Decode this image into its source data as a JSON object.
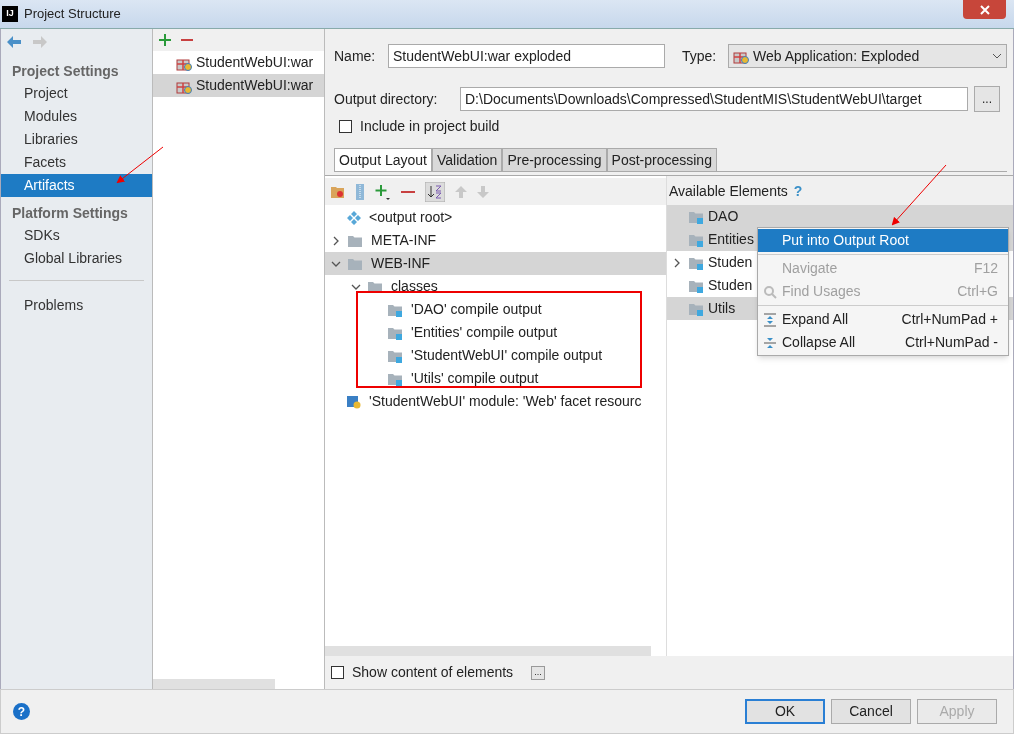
{
  "window": {
    "title": "Project Structure",
    "app_badge": "IJ"
  },
  "sidebar": {
    "sections": [
      {
        "title": "Project Settings",
        "items": [
          {
            "label": "Project",
            "selected": false
          },
          {
            "label": "Modules",
            "selected": false
          },
          {
            "label": "Libraries",
            "selected": false
          },
          {
            "label": "Facets",
            "selected": false
          },
          {
            "label": "Artifacts",
            "selected": true
          }
        ]
      },
      {
        "title": "Platform Settings",
        "items": [
          {
            "label": "SDKs",
            "selected": false
          },
          {
            "label": "Global Libraries",
            "selected": false
          }
        ]
      },
      {
        "items": [
          {
            "label": "Problems",
            "selected": false
          }
        ]
      }
    ]
  },
  "artifacts": [
    {
      "label": "StudentWebUI:war",
      "selected": false
    },
    {
      "label": "StudentWebUI:war",
      "selected": true
    }
  ],
  "form": {
    "name_label": "Name:",
    "name_value": "StudentWebUI:war exploded",
    "type_label": "Type:",
    "type_value": "Web Application: Exploded",
    "output_label": "Output directory:",
    "output_value": "D:\\Documents\\Downloads\\Compressed\\StudentMIS\\StudentWebUI\\target",
    "browse": "...",
    "include_label": "Include in project build",
    "include_checked": false
  },
  "tabs": [
    {
      "label": "Output Layout",
      "selected": true
    },
    {
      "label": "Validation",
      "selected": false
    },
    {
      "label": "Pre-processing",
      "selected": false
    },
    {
      "label": "Post-processing",
      "selected": false
    }
  ],
  "layout_tree": [
    {
      "kind": "root",
      "label": "<output root>",
      "selected": false
    },
    {
      "kind": "folder",
      "label": "META-INF",
      "expanded": false,
      "selected": false
    },
    {
      "kind": "folder",
      "label": "WEB-INF",
      "expanded": true,
      "selected": true,
      "children": [
        {
          "kind": "folder",
          "label": "classes",
          "expanded": true,
          "selected": false,
          "children": [
            {
              "kind": "output",
              "label": "'DAO' compile output",
              "selected": false
            },
            {
              "kind": "output",
              "label": "'Entities' compile output",
              "selected": false
            },
            {
              "kind": "output",
              "label": "'StudentWebUI' compile output",
              "selected": false
            },
            {
              "kind": "output",
              "label": "'Utils' compile output",
              "selected": false
            }
          ]
        }
      ]
    },
    {
      "kind": "facet",
      "label": "'StudentWebUI' module: 'Web' facet resourc",
      "selected": false
    }
  ],
  "available": {
    "title": "Available Elements",
    "help": "?",
    "items": [
      {
        "label": "DAO",
        "selected": true,
        "expandable": false
      },
      {
        "label": "Entities",
        "selected": true,
        "expandable": false
      },
      {
        "label": "Studen",
        "selected": false,
        "expandable": true
      },
      {
        "label": "Studen",
        "selected": false,
        "expandable": false
      },
      {
        "label": "Utils",
        "selected": true,
        "expandable": false
      }
    ]
  },
  "context_menu": [
    {
      "kind": "item",
      "label": "Put into Output Root",
      "selected": true,
      "disabled": false
    },
    {
      "kind": "separator"
    },
    {
      "kind": "item",
      "label": "Navigate",
      "shortcut": "F12",
      "selected": false,
      "disabled": true
    },
    {
      "kind": "finder",
      "label": "Find Usages",
      "shortcut": "Ctrl+G",
      "selected": false,
      "disabled": true
    },
    {
      "kind": "separator"
    },
    {
      "kind": "expander",
      "label": "Expand All",
      "shortcut": "Ctrl+NumPad +",
      "selected": false,
      "disabled": false
    },
    {
      "kind": "collapser",
      "label": "Collapse All",
      "shortcut": "Ctrl+NumPad -",
      "selected": false,
      "disabled": false
    }
  ],
  "show_content": {
    "label": "Show content of elements",
    "checked": false,
    "button": "..."
  },
  "help_button": "?",
  "buttons": [
    {
      "label": "OK",
      "kind": "default",
      "disabled": false
    },
    {
      "label": "Cancel",
      "kind": "normal",
      "disabled": false
    },
    {
      "label": "Apply",
      "kind": "normal",
      "disabled": true
    }
  ]
}
